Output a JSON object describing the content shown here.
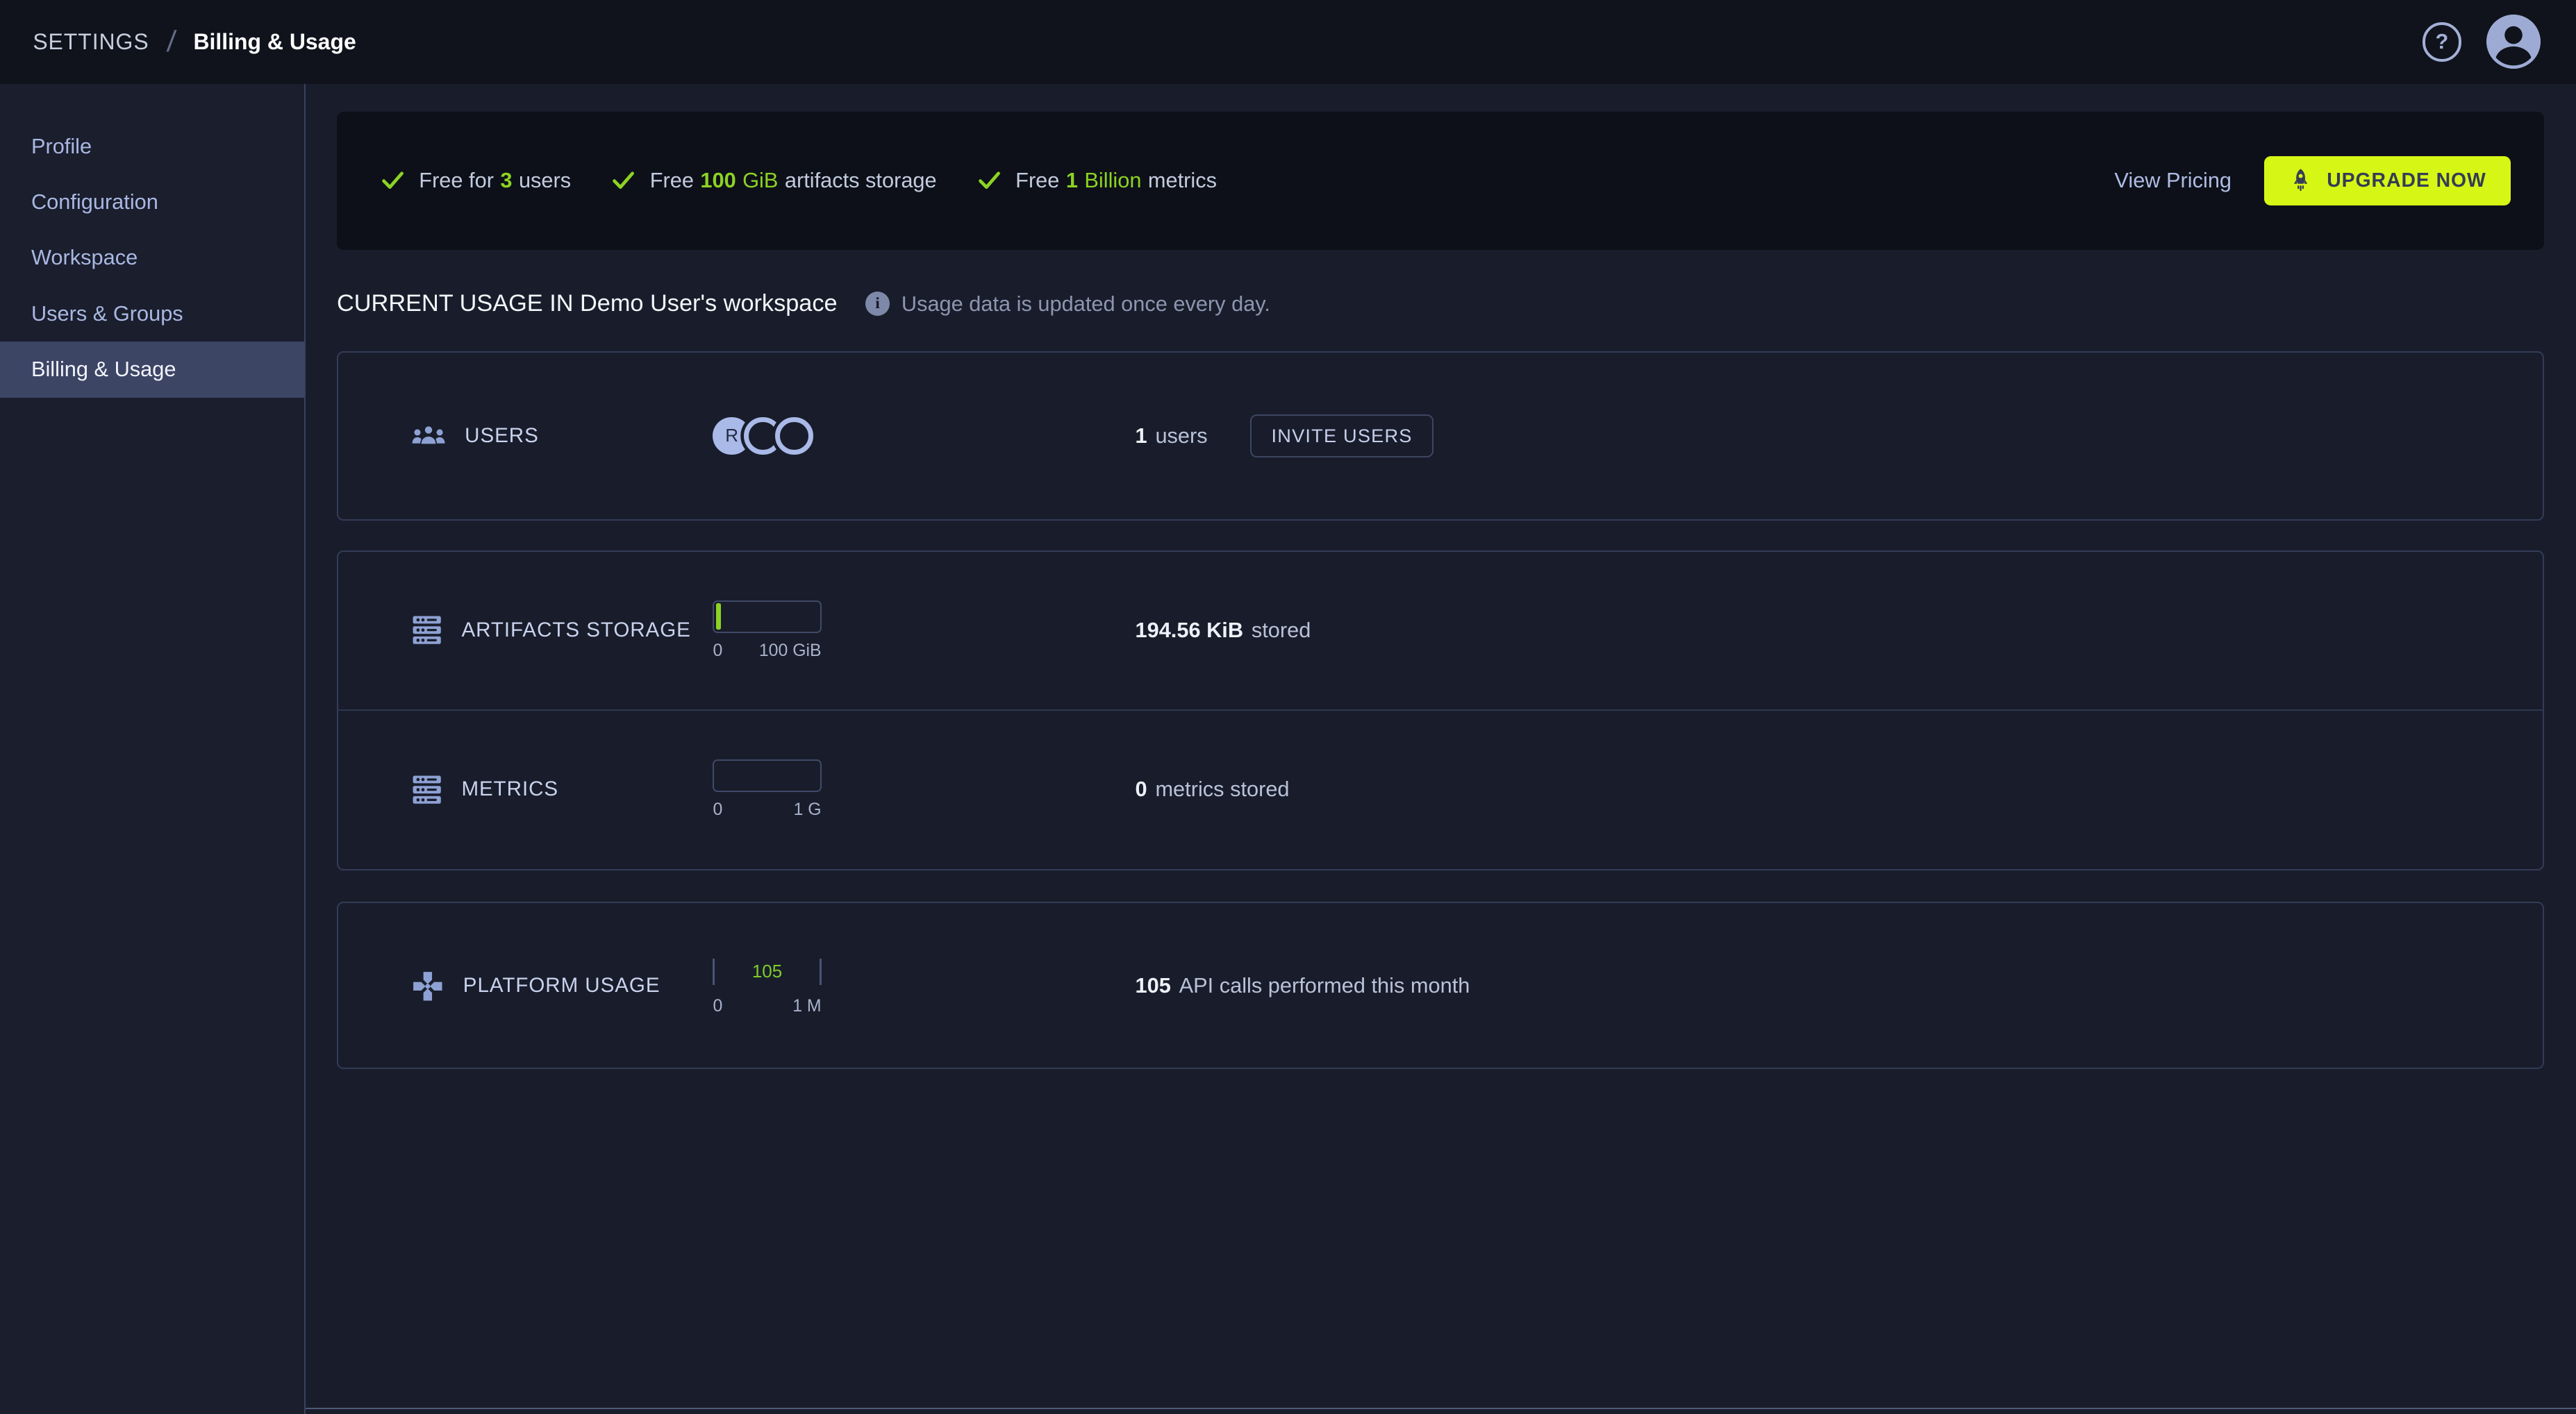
{
  "topbar": {
    "breadcrumb_root": "SETTINGS",
    "breadcrumb_separator": "/",
    "breadcrumb_current": "Billing & Usage",
    "help_glyph": "?"
  },
  "sidebar": {
    "items": [
      {
        "label": "Profile"
      },
      {
        "label": "Configuration"
      },
      {
        "label": "Workspace"
      },
      {
        "label": "Users & Groups"
      },
      {
        "label": "Billing & Usage"
      }
    ]
  },
  "banner": {
    "features": [
      {
        "pre": "Free for",
        "val": "3",
        "post": "users"
      },
      {
        "pre": "Free",
        "val": "100",
        "unit": "GiB",
        "post": "artifacts storage"
      },
      {
        "pre": "Free",
        "val": "1",
        "unit": "Billion",
        "post": "metrics"
      }
    ],
    "view_pricing_label": "View Pricing",
    "upgrade_label": "UPGRADE NOW"
  },
  "usage_header": {
    "title": "CURRENT USAGE IN Demo User's workspace",
    "info_glyph": "i",
    "note": "Usage data is updated once every day."
  },
  "cards": {
    "users": {
      "label": "USERS",
      "avatar_initial": "R",
      "count": "1",
      "count_suffix": "users",
      "invite_label": "INVITE USERS"
    },
    "artifacts": {
      "label": "ARTIFACTS STORAGE",
      "scale_min": "0",
      "scale_max": "100 GiB",
      "value": "194.56 KiB",
      "suffix": "stored"
    },
    "metrics": {
      "label": "METRICS",
      "scale_min": "0",
      "scale_max": "1 G",
      "value": "0",
      "suffix": "metrics stored"
    },
    "platform": {
      "label": "PLATFORM USAGE",
      "scale_min": "0",
      "scale_max": "1 M",
      "gauge_value": "105",
      "value": "105",
      "suffix": "API calls performed this month"
    }
  },
  "colors": {
    "accent_green": "#8cd323",
    "button_green": "#d6f715",
    "topbar_bg": "#10131c",
    "page_bg": "#191d2b",
    "selected_bg": "#3d4565",
    "periwinkle": "#a9b8e2"
  }
}
